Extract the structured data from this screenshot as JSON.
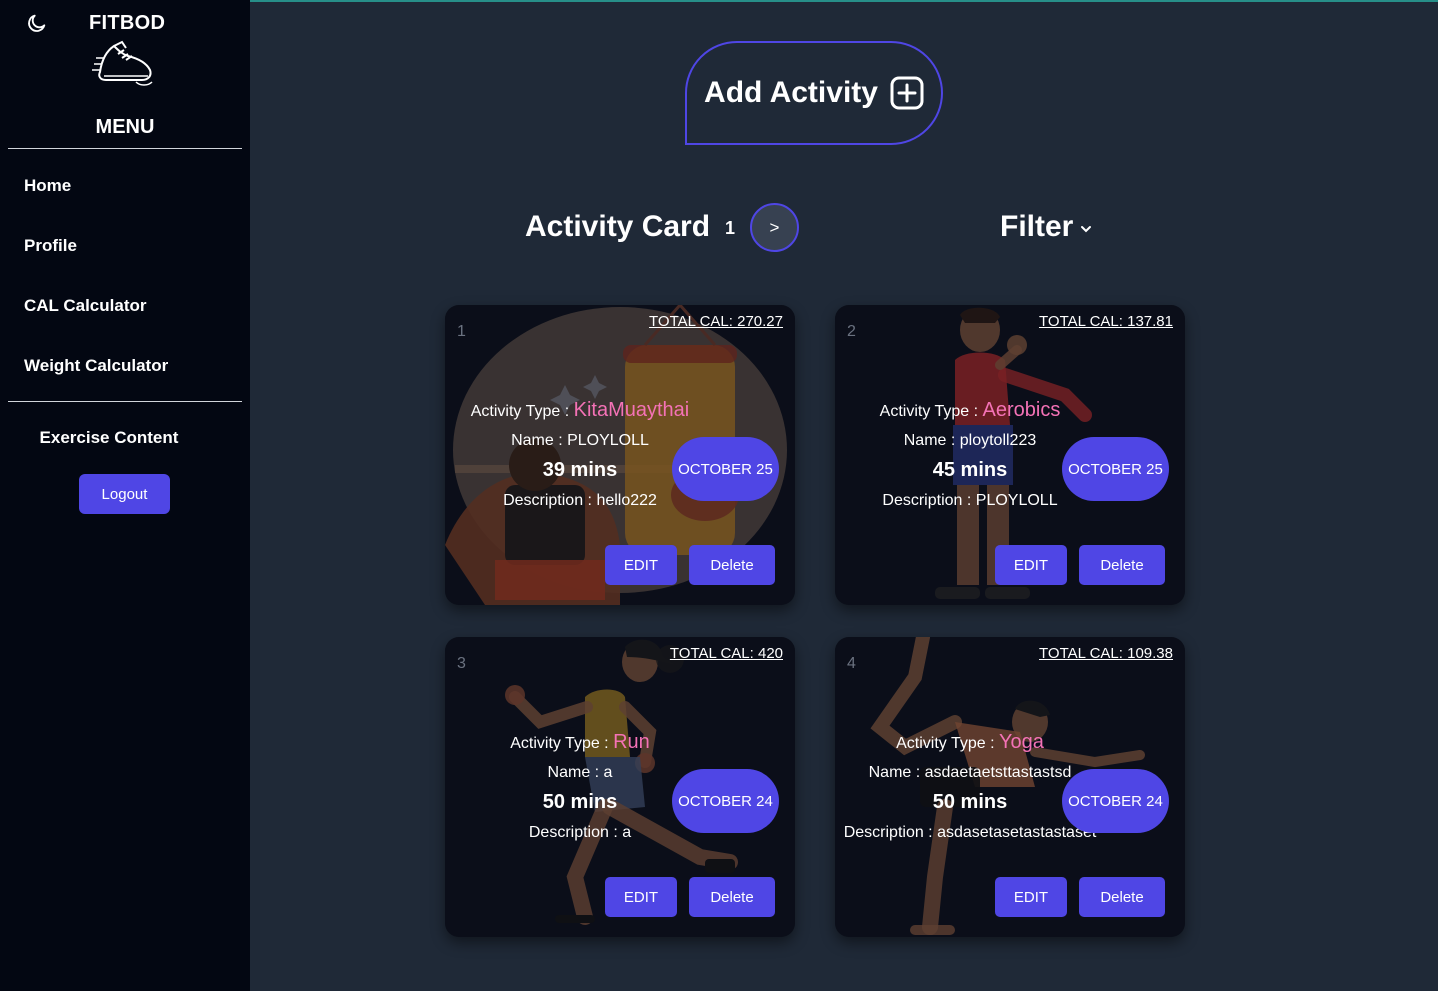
{
  "sidebar": {
    "brand": "FITBOD",
    "menu_title": "MENU",
    "items": [
      {
        "label": "Home"
      },
      {
        "label": "Profile"
      },
      {
        "label": "CAL Calculator"
      },
      {
        "label": "Weight Calculator"
      }
    ],
    "exercise_content": "Exercise Content",
    "logout": "Logout",
    "icons": [
      "moon-icon",
      "shoe-icon"
    ]
  },
  "main": {
    "add_activity": "Add Activity",
    "section_title": "Activity Card",
    "page_number": "1",
    "next_label": ">",
    "filter_label": "Filter"
  },
  "labels": {
    "activity_type": "Activity Type : ",
    "name": "Name : ",
    "description": "Description : ",
    "edit": "EDIT",
    "delete": "Delete"
  },
  "cards": [
    {
      "index": "1",
      "total_cal": "TOTAL CAL: 270.27",
      "type": "KitaMuaythai",
      "name": "PLOYLOLL",
      "mins": "39 mins",
      "description": "hello222",
      "date": "OCTOBER 25"
    },
    {
      "index": "2",
      "total_cal": "TOTAL CAL: 137.81",
      "type": "Aerobics",
      "name": "ploytoll223",
      "mins": "45 mins",
      "description": "PLOYLOLL",
      "date": "OCTOBER 25"
    },
    {
      "index": "3",
      "total_cal": "TOTAL CAL: 420",
      "type": "Run",
      "name": "a",
      "mins": "50 mins",
      "description": "a",
      "date": "OCTOBER 24"
    },
    {
      "index": "4",
      "total_cal": "TOTAL CAL: 109.38",
      "type": "Yoga",
      "name": "asdaetaetsttastastsd",
      "mins": "50 mins",
      "description": "asdasetasetastastaset",
      "date": "OCTOBER 24"
    }
  ],
  "colors": {
    "accent": "#4f46e5",
    "type_highlight": "#f472b6",
    "sidebar_bg": "#030712",
    "main_bg": "#1f2937",
    "card_bg": "#0b0f19"
  }
}
